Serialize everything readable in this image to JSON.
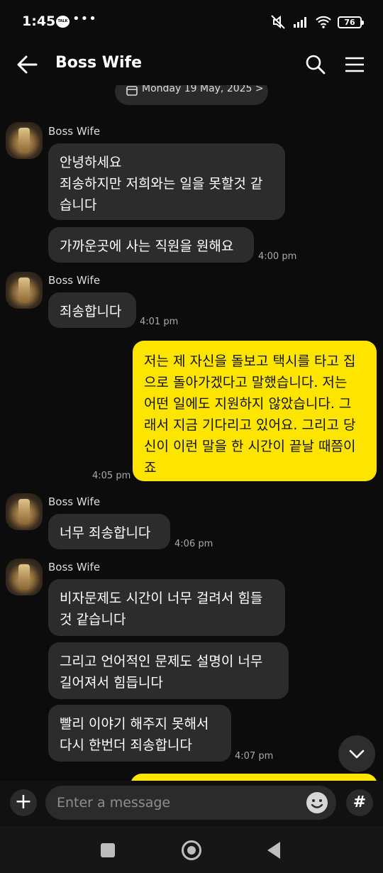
{
  "status_bar": {
    "time": "1:45",
    "talk_badge": "TALK",
    "dots": "•••",
    "battery": "76"
  },
  "header": {
    "title": "Boss Wife"
  },
  "date_pill": {
    "text": "Monday 19 May, 2025 >"
  },
  "messages": [
    {
      "sender": "Boss Wife",
      "text": "안녕하세요\n죄송하지만 저희와는 일을 못할것 같\n습니다"
    },
    {
      "text": "가까운곳에 사는 직원을 원해요",
      "time": "4:00 pm"
    },
    {
      "sender": "Boss Wife",
      "text": "죄송합니다",
      "time": "4:01 pm"
    },
    {
      "text": "저는 제 자신을 돌보고 택시를 타고 집\n으로 돌아가겠다고 말했습니다. 저는\n어떤 일에도 지원하지 않았습니다. 그\n래서 지금 기다리고 있어요. 그리고 당\n신이 이런 말을 한 시간이 끝날 때쯤이\n죠",
      "time": "4:05 pm"
    },
    {
      "sender": "Boss Wife",
      "text": "너무 죄송합니다",
      "time": "4:06 pm"
    },
    {
      "sender": "Boss Wife",
      "text": "비자문제도 시간이 너무 걸려서 힘들\n것 같습니다"
    },
    {
      "text": "그리고 언어적인 문제도 설명이 너무\n길어져서 힘듭니다"
    },
    {
      "text": "빨리 이야기 해주지 못해서\n다시 한번더 죄송합니다",
      "time": "4:07 pm"
    }
  ],
  "input": {
    "placeholder": "Enter a message",
    "hash": "#",
    "plus": "+"
  },
  "colors": {
    "background": "#0c0c0c",
    "incoming_bubble": "#2c2c2c",
    "outgoing_bubble": "#fee500"
  },
  "icons": [
    "back-arrow-icon",
    "search-icon",
    "menu-icon",
    "calendar-icon",
    "chevron-down-icon",
    "emoji-icon",
    "wifi-icon",
    "signal-icon",
    "mute-icon"
  ]
}
